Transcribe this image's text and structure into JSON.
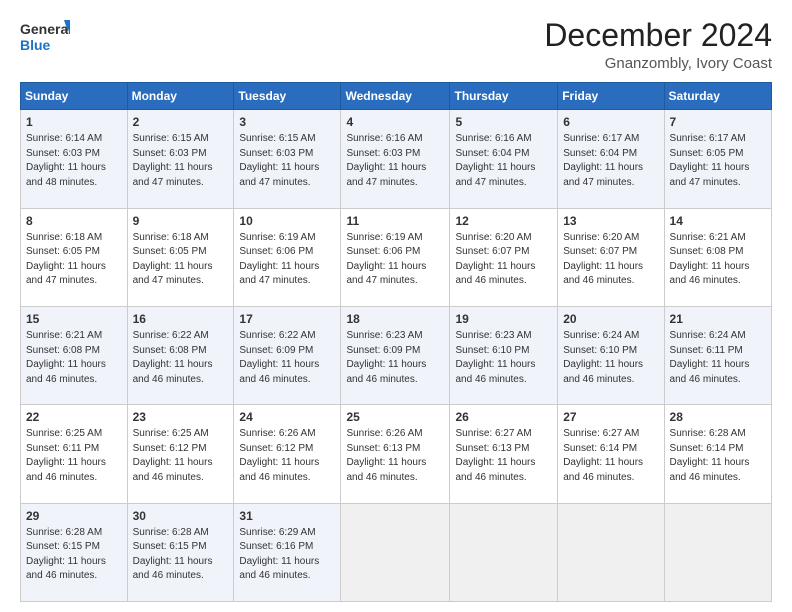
{
  "header": {
    "logo_line1": "General",
    "logo_line2": "Blue",
    "main_title": "December 2024",
    "subtitle": "Gnanzombly, Ivory Coast"
  },
  "calendar": {
    "days_of_week": [
      "Sunday",
      "Monday",
      "Tuesday",
      "Wednesday",
      "Thursday",
      "Friday",
      "Saturday"
    ],
    "weeks": [
      [
        {
          "day": "",
          "empty": true
        },
        {
          "day": "",
          "empty": true
        },
        {
          "day": "",
          "empty": true
        },
        {
          "day": "",
          "empty": true
        },
        {
          "day": "",
          "empty": true
        },
        {
          "day": "",
          "empty": true
        },
        {
          "day": "",
          "empty": true
        }
      ],
      [
        {
          "day": "1",
          "sunrise": "6:14 AM",
          "sunset": "6:03 PM",
          "daylight": "11 hours and 48 minutes."
        },
        {
          "day": "2",
          "sunrise": "6:15 AM",
          "sunset": "6:03 PM",
          "daylight": "11 hours and 47 minutes."
        },
        {
          "day": "3",
          "sunrise": "6:15 AM",
          "sunset": "6:03 PM",
          "daylight": "11 hours and 47 minutes."
        },
        {
          "day": "4",
          "sunrise": "6:16 AM",
          "sunset": "6:03 PM",
          "daylight": "11 hours and 47 minutes."
        },
        {
          "day": "5",
          "sunrise": "6:16 AM",
          "sunset": "6:04 PM",
          "daylight": "11 hours and 47 minutes."
        },
        {
          "day": "6",
          "sunrise": "6:17 AM",
          "sunset": "6:04 PM",
          "daylight": "11 hours and 47 minutes."
        },
        {
          "day": "7",
          "sunrise": "6:17 AM",
          "sunset": "6:05 PM",
          "daylight": "11 hours and 47 minutes."
        }
      ],
      [
        {
          "day": "8",
          "sunrise": "6:18 AM",
          "sunset": "6:05 PM",
          "daylight": "11 hours and 47 minutes."
        },
        {
          "day": "9",
          "sunrise": "6:18 AM",
          "sunset": "6:05 PM",
          "daylight": "11 hours and 47 minutes."
        },
        {
          "day": "10",
          "sunrise": "6:19 AM",
          "sunset": "6:06 PM",
          "daylight": "11 hours and 47 minutes."
        },
        {
          "day": "11",
          "sunrise": "6:19 AM",
          "sunset": "6:06 PM",
          "daylight": "11 hours and 47 minutes."
        },
        {
          "day": "12",
          "sunrise": "6:20 AM",
          "sunset": "6:07 PM",
          "daylight": "11 hours and 46 minutes."
        },
        {
          "day": "13",
          "sunrise": "6:20 AM",
          "sunset": "6:07 PM",
          "daylight": "11 hours and 46 minutes."
        },
        {
          "day": "14",
          "sunrise": "6:21 AM",
          "sunset": "6:08 PM",
          "daylight": "11 hours and 46 minutes."
        }
      ],
      [
        {
          "day": "15",
          "sunrise": "6:21 AM",
          "sunset": "6:08 PM",
          "daylight": "11 hours and 46 minutes."
        },
        {
          "day": "16",
          "sunrise": "6:22 AM",
          "sunset": "6:08 PM",
          "daylight": "11 hours and 46 minutes."
        },
        {
          "day": "17",
          "sunrise": "6:22 AM",
          "sunset": "6:09 PM",
          "daylight": "11 hours and 46 minutes."
        },
        {
          "day": "18",
          "sunrise": "6:23 AM",
          "sunset": "6:09 PM",
          "daylight": "11 hours and 46 minutes."
        },
        {
          "day": "19",
          "sunrise": "6:23 AM",
          "sunset": "6:10 PM",
          "daylight": "11 hours and 46 minutes."
        },
        {
          "day": "20",
          "sunrise": "6:24 AM",
          "sunset": "6:10 PM",
          "daylight": "11 hours and 46 minutes."
        },
        {
          "day": "21",
          "sunrise": "6:24 AM",
          "sunset": "6:11 PM",
          "daylight": "11 hours and 46 minutes."
        }
      ],
      [
        {
          "day": "22",
          "sunrise": "6:25 AM",
          "sunset": "6:11 PM",
          "daylight": "11 hours and 46 minutes."
        },
        {
          "day": "23",
          "sunrise": "6:25 AM",
          "sunset": "6:12 PM",
          "daylight": "11 hours and 46 minutes."
        },
        {
          "day": "24",
          "sunrise": "6:26 AM",
          "sunset": "6:12 PM",
          "daylight": "11 hours and 46 minutes."
        },
        {
          "day": "25",
          "sunrise": "6:26 AM",
          "sunset": "6:13 PM",
          "daylight": "11 hours and 46 minutes."
        },
        {
          "day": "26",
          "sunrise": "6:27 AM",
          "sunset": "6:13 PM",
          "daylight": "11 hours and 46 minutes."
        },
        {
          "day": "27",
          "sunrise": "6:27 AM",
          "sunset": "6:14 PM",
          "daylight": "11 hours and 46 minutes."
        },
        {
          "day": "28",
          "sunrise": "6:28 AM",
          "sunset": "6:14 PM",
          "daylight": "11 hours and 46 minutes."
        }
      ],
      [
        {
          "day": "29",
          "sunrise": "6:28 AM",
          "sunset": "6:15 PM",
          "daylight": "11 hours and 46 minutes."
        },
        {
          "day": "30",
          "sunrise": "6:28 AM",
          "sunset": "6:15 PM",
          "daylight": "11 hours and 46 minutes."
        },
        {
          "day": "31",
          "sunrise": "6:29 AM",
          "sunset": "6:16 PM",
          "daylight": "11 hours and 46 minutes."
        },
        {
          "day": "",
          "empty": true
        },
        {
          "day": "",
          "empty": true
        },
        {
          "day": "",
          "empty": true
        },
        {
          "day": "",
          "empty": true
        }
      ]
    ]
  }
}
